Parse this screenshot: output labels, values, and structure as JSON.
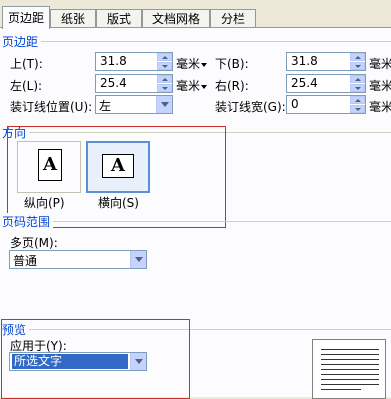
{
  "tabs": [
    {
      "label": "页边距"
    },
    {
      "label": "纸张"
    },
    {
      "label": "版式"
    },
    {
      "label": "文档网格"
    },
    {
      "label": "分栏"
    }
  ],
  "margins": {
    "group_title": "页边距",
    "top": {
      "label": "上(T):",
      "value": "31.8",
      "unit": "毫米"
    },
    "bottom": {
      "label": "下(B):",
      "value": "31.8",
      "unit": "毫米"
    },
    "left": {
      "label": "左(L):",
      "value": "25.4",
      "unit": "毫米"
    },
    "right": {
      "label": "右(R):",
      "value": "25.4",
      "unit": "毫米"
    },
    "gutter_position": {
      "label": "装订线位置(U):",
      "value": "左"
    },
    "gutter": {
      "label": "装订线宽(G):",
      "value": "0"
    }
  },
  "orientation": {
    "group_title": "方向",
    "portrait": {
      "label": "纵向(P)",
      "glyph": "A"
    },
    "landscape": {
      "label": "横向(S)",
      "glyph": "A",
      "selected": true
    }
  },
  "pages": {
    "group_title": "页码范围",
    "multiple_label": "多页(M):",
    "multiple_value": "普通"
  },
  "preview": {
    "group_title": "预览",
    "apply_to_label": "应用于(Y):",
    "apply_to_value": "所选文字"
  },
  "colors": {
    "accent": "#316ac5",
    "group_title": "#0046d5",
    "highlight_box": "#c9302c"
  }
}
